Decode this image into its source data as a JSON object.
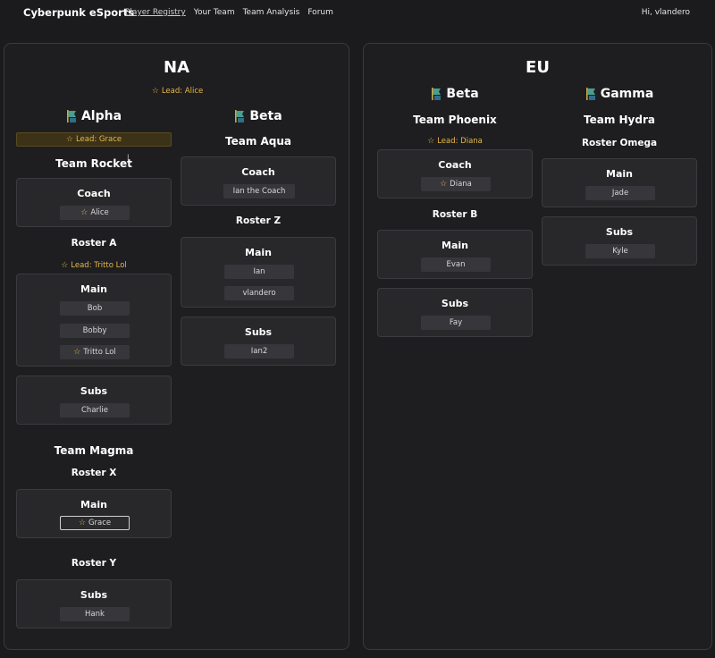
{
  "nav": {
    "brand": "Cyberpunk eSports",
    "links": [
      "Player Registry",
      "Your Team",
      "Team Analysis",
      "Forum"
    ],
    "greeting": "Hi, vlandero"
  },
  "colors": {
    "accent_gold": "#e6b84a",
    "background": "#1b1b1d",
    "card": "#28282b"
  },
  "icons": {
    "league": "league-banner-icon",
    "star": "star-icon"
  },
  "na": {
    "title": "NA",
    "lead": "Lead: Alice",
    "alpha": {
      "title": "Alpha",
      "lead": "Lead: Grace",
      "team_rocket": {
        "name": "Team Rocket",
        "coach": {
          "title": "Coach",
          "players": [
            "Alice"
          ]
        },
        "roster_a": {
          "name": "Roster A",
          "lead": "Lead: Tritto Lol",
          "main": {
            "title": "Main",
            "players": [
              "Bob",
              "Bobby",
              "Tritto Lol"
            ]
          },
          "subs": {
            "title": "Subs",
            "players": [
              "Charlie"
            ]
          }
        }
      },
      "team_magma": {
        "name": "Team Magma",
        "roster_x": {
          "name": "Roster X",
          "main": {
            "title": "Main",
            "players": [
              "Grace"
            ]
          }
        },
        "roster_y": {
          "name": "Roster Y",
          "subs": {
            "title": "Subs",
            "players": [
              "Hank"
            ]
          }
        }
      }
    },
    "beta": {
      "title": "Beta",
      "team_aqua": {
        "name": "Team Aqua",
        "coach": {
          "title": "Coach",
          "players": [
            "Ian the Coach"
          ]
        },
        "roster_z": {
          "name": "Roster Z",
          "main": {
            "title": "Main",
            "players": [
              "Ian",
              "vlandero"
            ]
          },
          "subs": {
            "title": "Subs",
            "players": [
              "Ian2"
            ]
          }
        }
      }
    }
  },
  "eu": {
    "title": "EU",
    "beta": {
      "title": "Beta",
      "team_phoenix": {
        "name": "Team Phoenix",
        "lead": "Lead: Diana",
        "coach": {
          "title": "Coach",
          "players": [
            "Diana"
          ]
        },
        "roster_b": {
          "name": "Roster B",
          "main": {
            "title": "Main",
            "players": [
              "Evan"
            ]
          },
          "subs": {
            "title": "Subs",
            "players": [
              "Fay"
            ]
          }
        }
      }
    },
    "gamma": {
      "title": "Gamma",
      "team_hydra": {
        "name": "Team Hydra",
        "roster_omega": {
          "name": "Roster Omega",
          "main": {
            "title": "Main",
            "players": [
              "Jade"
            ]
          },
          "subs": {
            "title": "Subs",
            "players": [
              "Kyle"
            ]
          }
        }
      }
    }
  }
}
